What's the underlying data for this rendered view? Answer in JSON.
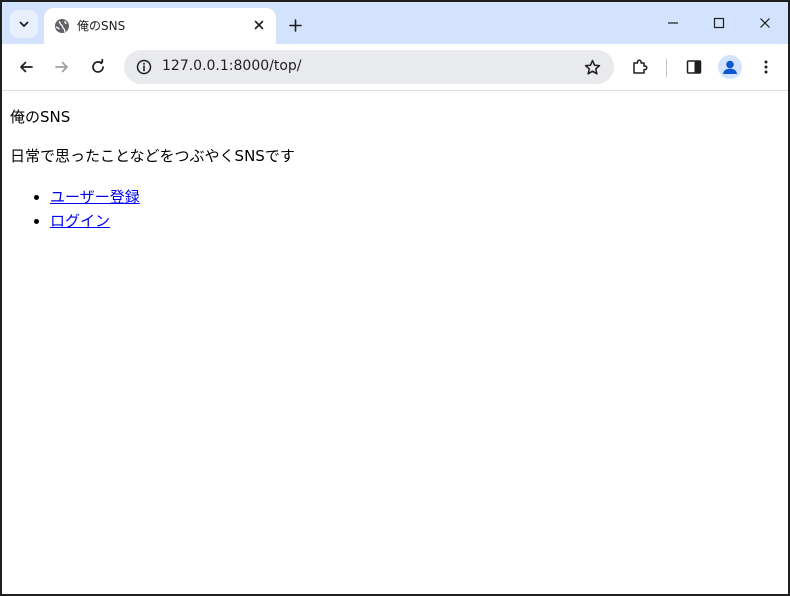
{
  "browser": {
    "tab": {
      "title": "俺のSNS",
      "favicon": "globe-icon"
    },
    "address_bar": {
      "url": "127.0.0.1:8000/top/"
    },
    "icons": {
      "tab_search": "chevron-down-icon",
      "close_tab": "close-icon",
      "new_tab": "plus-icon",
      "minimize": "minimize-icon",
      "maximize": "maximize-icon",
      "close_window": "close-icon",
      "back": "arrow-left-icon",
      "forward": "arrow-right-icon",
      "reload": "reload-icon",
      "site_info": "info-icon",
      "bookmark": "star-icon",
      "extensions": "puzzle-icon",
      "side_panel": "side-panel-icon",
      "profile": "person-icon",
      "menu": "kebab-menu-icon"
    },
    "colors": {
      "tabstrip_bg": "#d3e3fd",
      "omnibox_bg": "#e8eaed",
      "accent": "#0b57d0",
      "link": "#0000ee"
    }
  },
  "page": {
    "heading": "俺のSNS",
    "description": "日常で思ったことなどをつぶやくSNSです",
    "links": [
      {
        "label": "ユーザー登録"
      },
      {
        "label": "ログイン"
      }
    ]
  }
}
